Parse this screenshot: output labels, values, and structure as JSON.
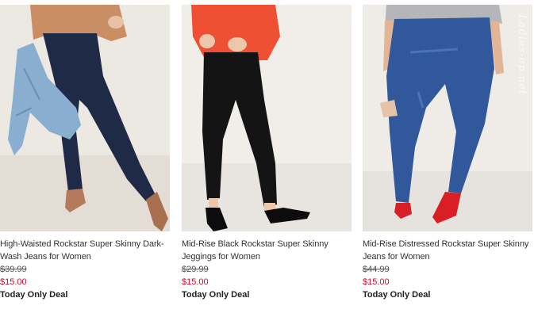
{
  "products": [
    {
      "title": "High-Waisted Rockstar Super Skinny Dark-Wash Jeans for Women",
      "original_price": "$39.99",
      "sale_price": "$15.00",
      "deal": "Today Only Deal",
      "image_icon": "model-dark-wash-jeans-image"
    },
    {
      "title": "Mid-Rise Black Rockstar Super Skinny Jeggings for Women",
      "original_price": "$29.99",
      "sale_price": "$15.00",
      "deal": "Today Only Deal",
      "image_icon": "model-black-jeggings-image"
    },
    {
      "title": "Mid-Rise Distressed Rockstar Super Skinny Jeans for Women",
      "original_price": "$44.99",
      "sale_price": "$15.00",
      "deal": "Today Only Deal",
      "image_icon": "model-distressed-jeans-image"
    }
  ],
  "watermark": "Ladies-ep.net",
  "colors": {
    "sale_price": "#c8102e",
    "title_text": "#333333"
  }
}
